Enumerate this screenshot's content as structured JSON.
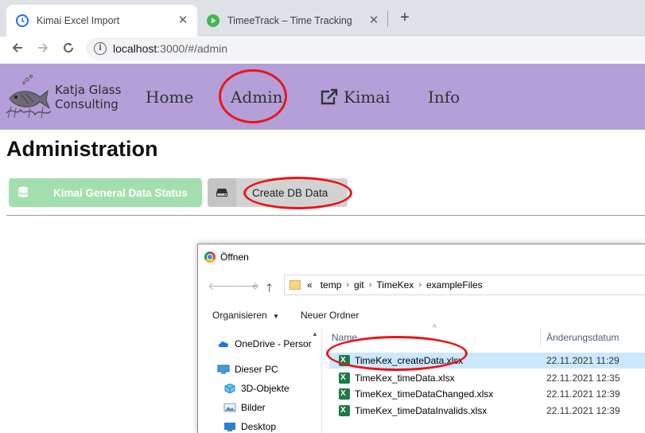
{
  "browser": {
    "tabs": [
      {
        "title": "Kimai Excel Import",
        "active": true,
        "favicon": "clock-icon"
      },
      {
        "title": "TimeeTrack – Time Tracking",
        "active": false,
        "favicon": "play-icon"
      }
    ],
    "new_tab": "+",
    "address": {
      "host": "localhost",
      "path": ":3000/#/admin"
    }
  },
  "header": {
    "brand_line1": "Katja Glass",
    "brand_line2": "Consulting",
    "nav": [
      {
        "label": "Home"
      },
      {
        "label": "Admin",
        "highlighted": true
      },
      {
        "label": "Kimai",
        "icon": "external-link-icon"
      },
      {
        "label": "Info"
      }
    ],
    "bg_color": "#b49fd9"
  },
  "page": {
    "title": "Administration",
    "buttons": [
      {
        "label": "Kimai General Data Status",
        "icon": "database-icon",
        "color": "#a3dfae",
        "disabled": true
      },
      {
        "label": "Create DB Data",
        "icon": "hdd-icon",
        "color": "#d2d2d2",
        "highlighted": true
      }
    ]
  },
  "dialog": {
    "title": "Öffnen",
    "breadcrumb": [
      "«",
      "temp",
      "git",
      "TimeKex",
      "exampleFiles"
    ],
    "commands": {
      "organize": "Organisieren",
      "new_folder": "Neuer Ordner"
    },
    "nav_items": [
      {
        "label": "OneDrive - Persor",
        "icon": "cloud-icon"
      },
      {
        "label": "Dieser PC",
        "icon": "computer-icon"
      },
      {
        "label": "3D-Objekte",
        "icon": "cube-icon"
      },
      {
        "label": "Bilder",
        "icon": "pictures-icon"
      },
      {
        "label": "Desktop",
        "icon": "desktop-icon"
      }
    ],
    "columns": {
      "name": "Name",
      "date": "Änderungsdatum"
    },
    "files": [
      {
        "name": "TimeKex_createData.xlsx",
        "date": "22.11.2021 11:29",
        "selected": true
      },
      {
        "name": "TimeKex_timeData.xlsx",
        "date": "22.11.2021 12:35",
        "selected": false
      },
      {
        "name": "TimeKex_timeDataChanged.xlsx",
        "date": "22.11.2021 12:39",
        "selected": false
      },
      {
        "name": "TimeKex_timeDataInvalids.xlsx",
        "date": "22.11.2021 12:39",
        "selected": false
      }
    ]
  },
  "colors": {
    "highlight_circle": "#e8171d",
    "selected_row": "#cce8ff"
  }
}
